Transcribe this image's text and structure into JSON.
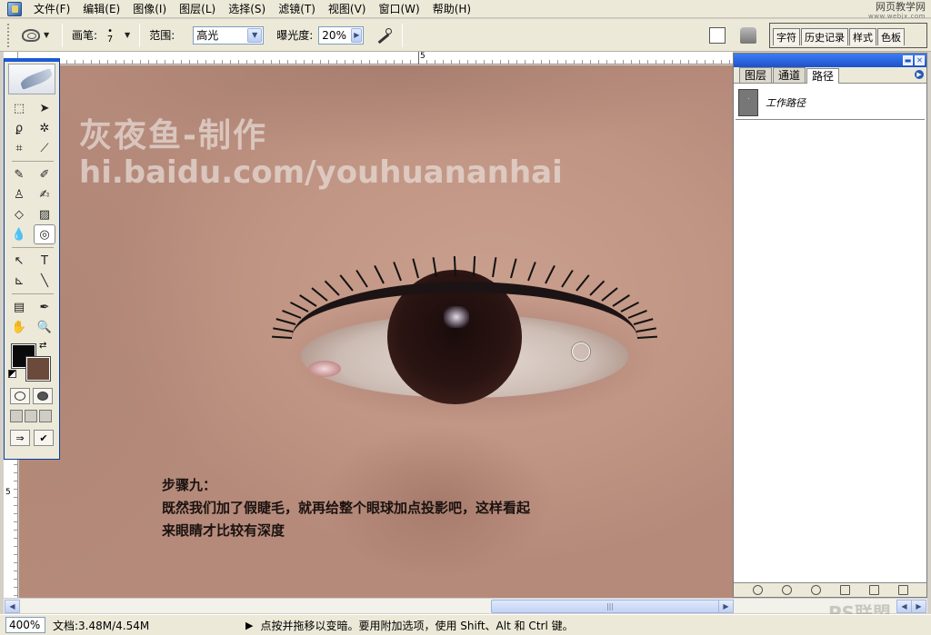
{
  "menubar": {
    "items": [
      "文件(F)",
      "编辑(E)",
      "图像(I)",
      "图层(L)",
      "选择(S)",
      "滤镜(T)",
      "视图(V)",
      "窗口(W)",
      "帮助(H)"
    ],
    "logo_text": "网页教学网",
    "logo_subtext": "www.webjx.com"
  },
  "options": {
    "brush_label": "画笔:",
    "brush_size": "7",
    "range_label": "范围:",
    "range_value": "高光",
    "exposure_label": "曝光度:",
    "exposure_value": "20%",
    "palette_well_tabs": [
      "字符",
      "历史记录",
      "样式",
      "色板"
    ]
  },
  "rulers": {
    "top_label": "5",
    "left_label": "5"
  },
  "canvas": {
    "watermark_title": "灰夜鱼-制作",
    "watermark_url": "hi.baidu.com/youhuananhai",
    "step_title": "步骤九：",
    "step_line1": "既然我们加了假睫毛，就再给整个眼球加点投影吧，这样看起",
    "step_line2": "来眼睛才比较有深度"
  },
  "colors": {
    "foreground": "#0a0a0a",
    "background": "#6b4a3c"
  },
  "paths_panel": {
    "tabs": [
      "图层",
      "通道",
      "路径"
    ],
    "active_tab": "路径",
    "items": [
      {
        "name": "工作路径"
      }
    ]
  },
  "statusbar": {
    "zoom": "400%",
    "doc_info": "文档:3.48M/4.54M",
    "hint": "点按并拖移以变暗。要用附加选项，使用 Shift、Alt 和 Ctrl 键。"
  },
  "site_watermark": "PS联盟"
}
